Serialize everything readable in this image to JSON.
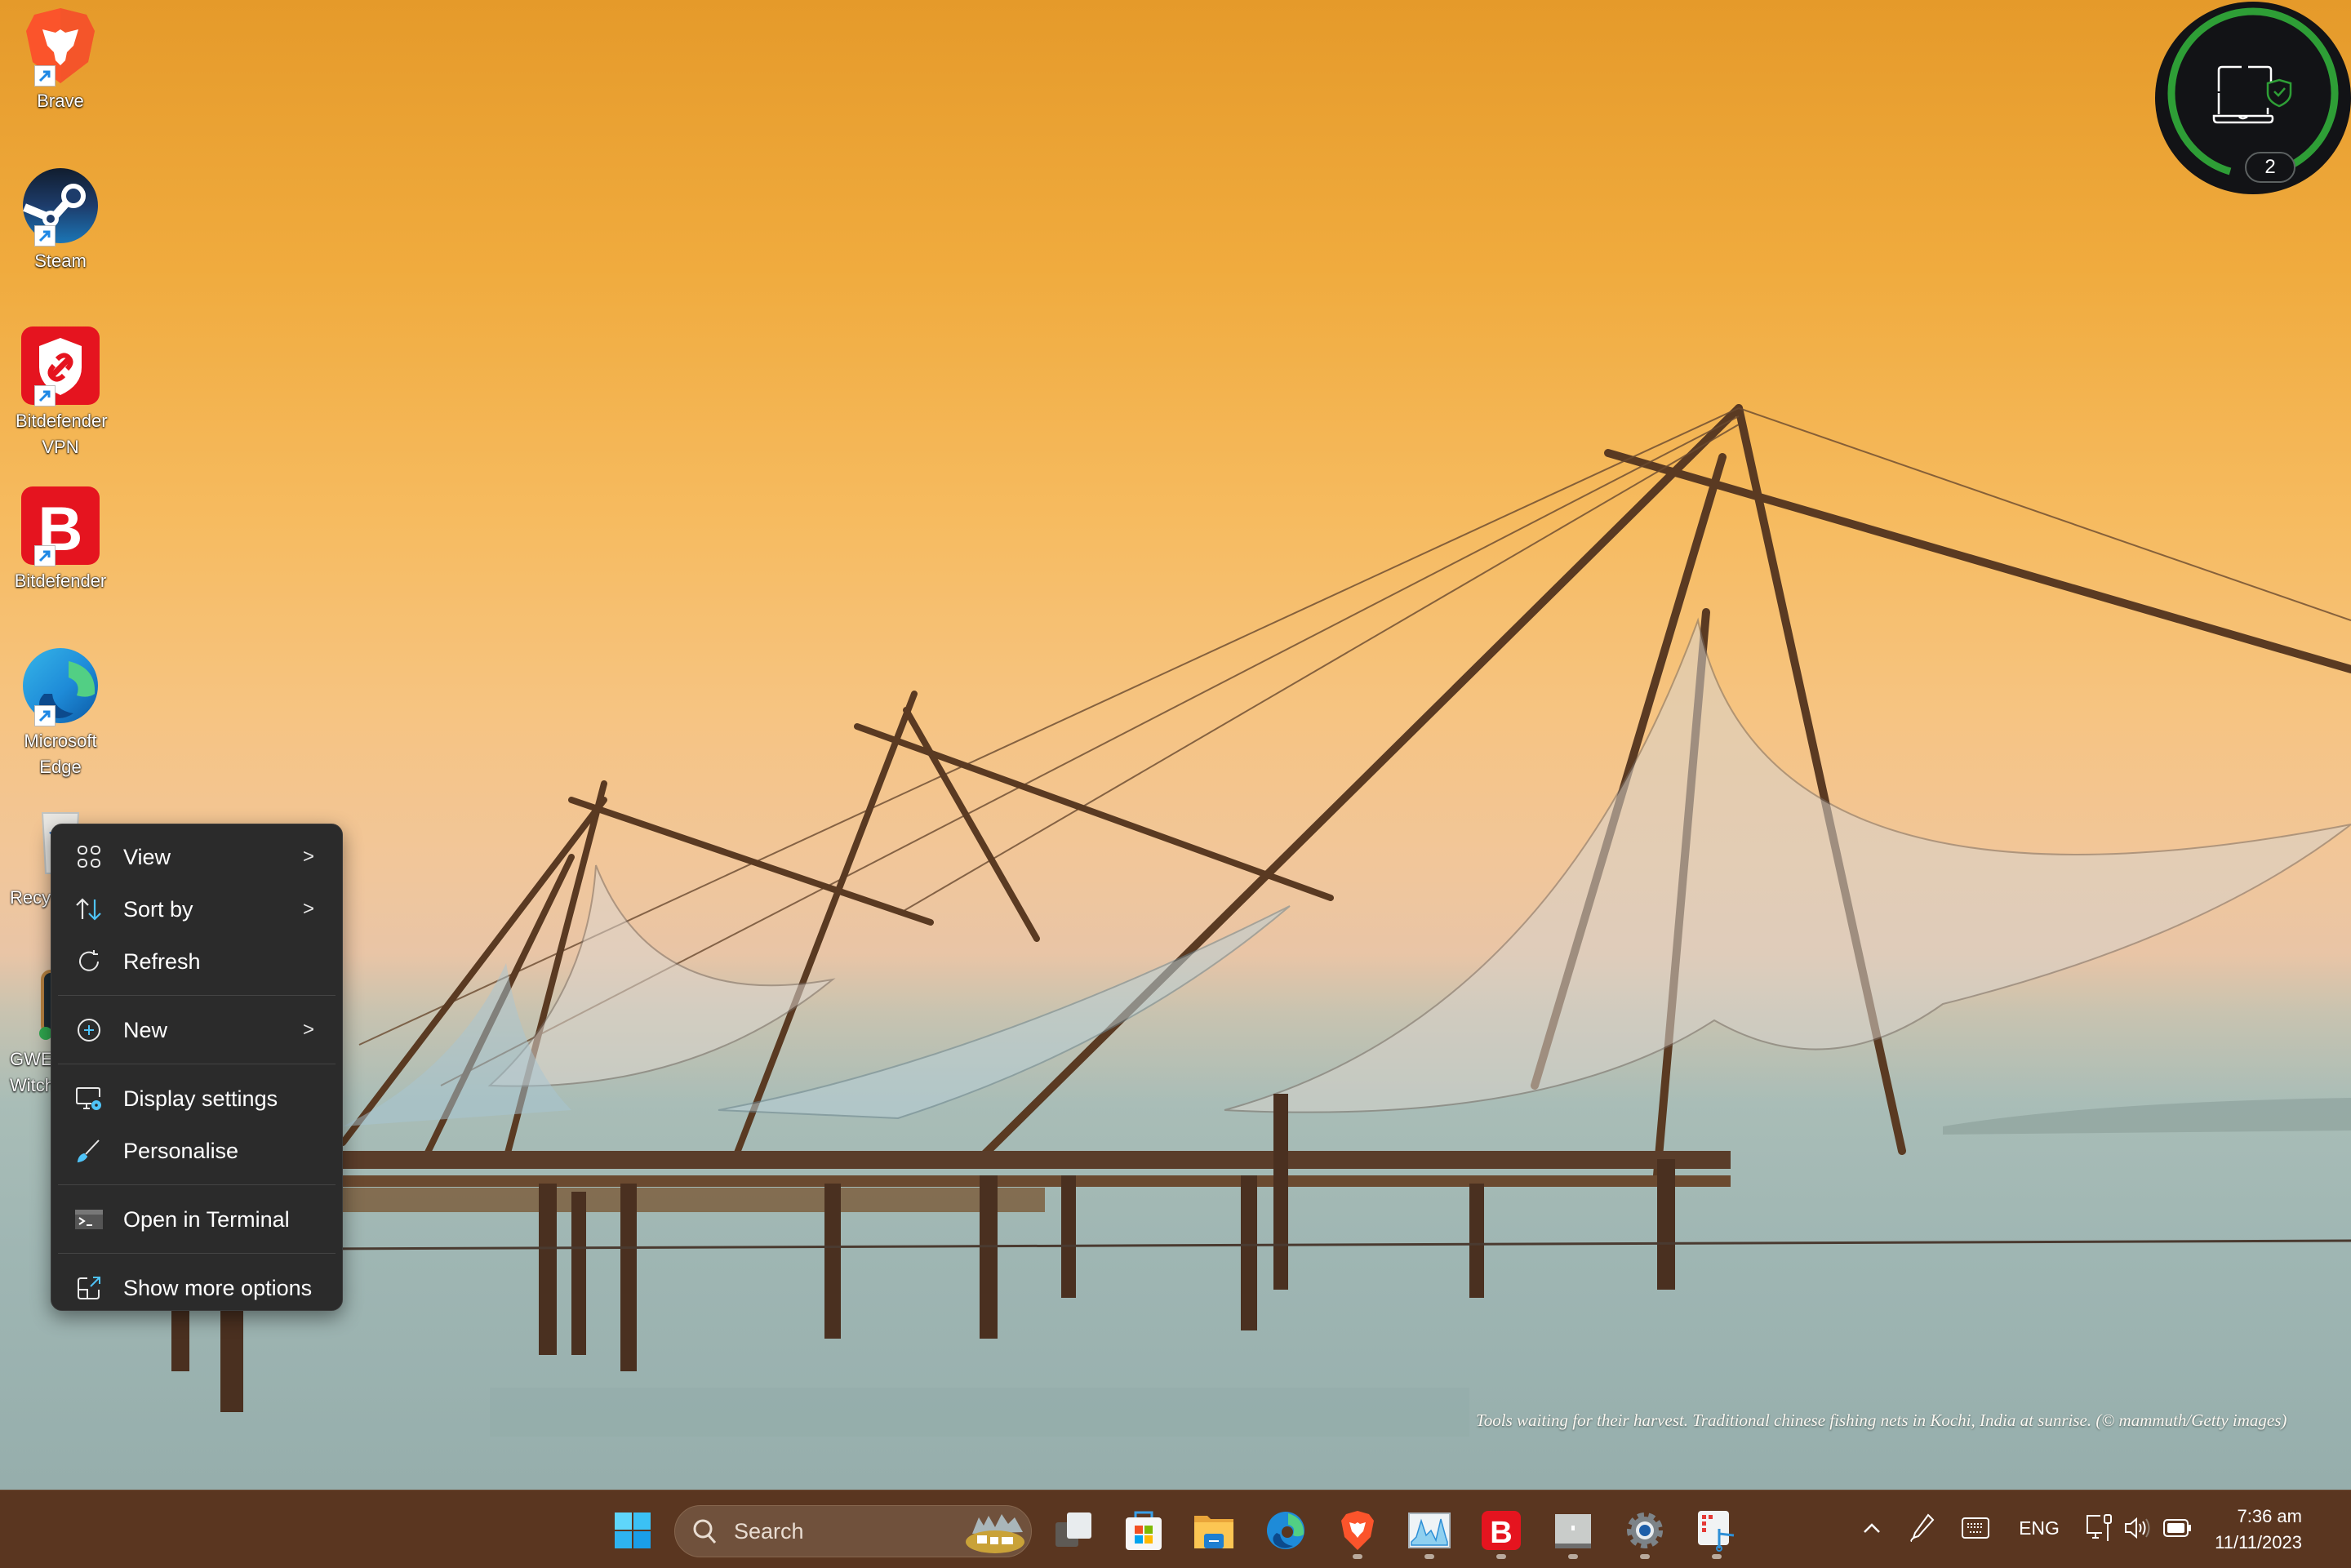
{
  "desktop": {
    "icons": [
      {
        "label": "Brave",
        "icon": "brave-icon"
      },
      {
        "label": "Steam",
        "icon": "steam-icon"
      },
      {
        "label": "Bitdefender VPN",
        "icon": "bitdefender-vpn-icon"
      },
      {
        "label": "Bitdefender",
        "icon": "bitdefender-icon"
      },
      {
        "label": "Microsoft Edge",
        "icon": "edge-icon"
      },
      {
        "label": "Recy",
        "icon": "recycle-bin-icon"
      },
      {
        "label": "GWE Witch",
        "icon": "gwent-icon"
      }
    ],
    "wallpaper_caption": "Tools waiting for their harvest. Traditional chinese fishing nets in Kochi, India at sunrise. (© mammuth/Getty images)"
  },
  "context_menu": {
    "items": [
      {
        "label": "View",
        "icon": "grid-view-icon",
        "submenu": true
      },
      {
        "label": "Sort by",
        "icon": "sort-icon",
        "submenu": true
      },
      {
        "label": "Refresh",
        "icon": "refresh-icon",
        "submenu": false
      },
      {
        "label": "New",
        "icon": "plus-circle-icon",
        "submenu": true
      },
      {
        "label": "Display settings",
        "icon": "display-settings-icon",
        "submenu": false
      },
      {
        "label": "Personalise",
        "icon": "brush-icon",
        "submenu": false
      },
      {
        "label": "Open in Terminal",
        "icon": "terminal-icon",
        "submenu": false
      },
      {
        "label": "Show more options",
        "icon": "show-more-icon",
        "submenu": false
      }
    ],
    "chevron": ">"
  },
  "security_widget": {
    "count": "2",
    "status_color": "#2e9e36"
  },
  "taskbar": {
    "search_placeholder": "Search",
    "apps": [
      {
        "name": "Task View",
        "running": false
      },
      {
        "name": "Microsoft Store",
        "running": false
      },
      {
        "name": "File Explorer",
        "running": false
      },
      {
        "name": "Microsoft Edge",
        "running": false
      },
      {
        "name": "Brave",
        "running": true
      },
      {
        "name": "Resource Monitor",
        "running": true
      },
      {
        "name": "Bitdefender",
        "running": true
      },
      {
        "name": "App Window",
        "running": true
      },
      {
        "name": "Settings",
        "running": true
      },
      {
        "name": "Snipping Tool",
        "running": true
      }
    ],
    "tray": {
      "language": "ENG",
      "time": "7:36 am",
      "date": "11/11/2023"
    }
  }
}
